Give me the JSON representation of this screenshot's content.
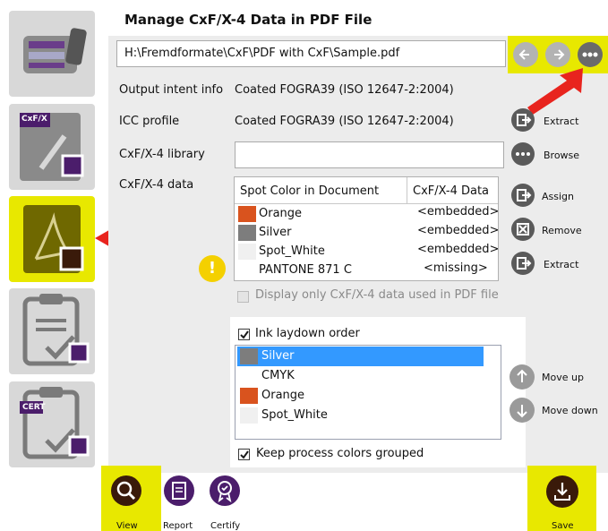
{
  "window": {
    "title": "Manage CxF/X-4 Data in PDF File"
  },
  "file": {
    "path": "H:\\Fremdformate\\CxF\\PDF with CxF\\Sample.pdf"
  },
  "fields": {
    "output_intent_label": "Output intent info",
    "output_intent_value": "Coated FOGRA39 (ISO 12647-2:2004)",
    "icc_label": "ICC profile",
    "icc_value": "Coated FOGRA39 (ISO 12647-2:2004)",
    "library_label": "CxF/X-4 library",
    "library_value": "",
    "data_label": "CxF/X-4 data"
  },
  "actions": {
    "extract_profile": "Extract",
    "browse": "Browse",
    "assign": "Assign",
    "remove": "Remove",
    "extract_data": "Extract",
    "move_up": "Move up",
    "move_down": "Move down"
  },
  "spot_table": {
    "col1": "Spot Color in Document",
    "col2": "CxF/X-4 Data",
    "rows": [
      {
        "name": "Orange",
        "data": "<embedded>",
        "color": "#d9531e"
      },
      {
        "name": "Silver",
        "data": "<embedded>",
        "color": "#7d7d7d"
      },
      {
        "name": "Spot_White",
        "data": "<embedded>",
        "color": "#f0f0f0"
      },
      {
        "name": "PANTONE 871 C",
        "data": "<missing>",
        "color": ""
      }
    ]
  },
  "warning_glyph": "!",
  "checkboxes": {
    "display_only": "Display only CxF/X-4 data used in PDF file",
    "ink_order": "Ink laydown order",
    "keep_grouped": "Keep process colors grouped"
  },
  "ink_list": [
    {
      "name": "Silver",
      "color": "#7d7d7d",
      "selected": true
    },
    {
      "name": "CMYK",
      "color": "",
      "selected": false
    },
    {
      "name": "Orange",
      "color": "#d9531e",
      "selected": false
    },
    {
      "name": "Spot_White",
      "color": "#f0f0f0",
      "selected": false
    }
  ],
  "bottom": {
    "view": "View",
    "report": "Report",
    "certify": "Certify",
    "save": "Save"
  },
  "sidebar": {
    "cxfx_badge": "CxF/X",
    "cert_badge": "CERT"
  },
  "colors": {
    "accent_yellow": "#e8e800",
    "purple": "#4b1d6b",
    "arrow_red": "#e8241e",
    "selection": "#3399ff"
  }
}
